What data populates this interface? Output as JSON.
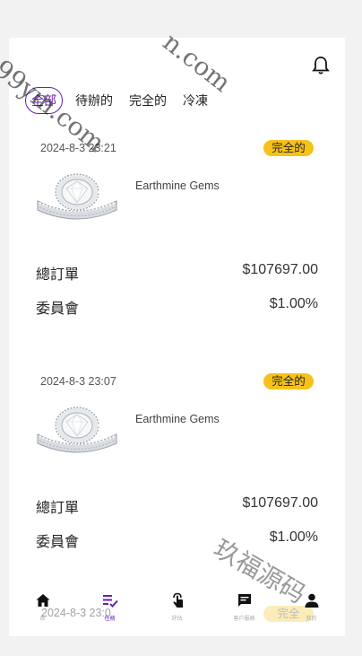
{
  "tabs": [
    {
      "label": "全部",
      "active": true
    },
    {
      "label": "待辦的",
      "active": false
    },
    {
      "label": "完全的",
      "active": false
    },
    {
      "label": "冷凍",
      "active": false
    }
  ],
  "orders": [
    {
      "date": "2024-8-3 23:21",
      "status": "完全的",
      "merchant": "Earthmine Gems",
      "total_label": "總訂單",
      "total_value": "$107697.00",
      "commission_label": "委員會",
      "commission_value": "$1.00%"
    },
    {
      "date": "2024-8-3 23:07",
      "status": "完全的",
      "merchant": "Earthmine Gems",
      "total_label": "總訂單",
      "total_value": "$107697.00",
      "commission_label": "委員會",
      "commission_value": "$1.00%"
    },
    {
      "date": "2024-8-3 23:0",
      "status": "完全"
    }
  ],
  "nav": [
    {
      "label": "首",
      "icon": "home-icon"
    },
    {
      "label": "任務",
      "icon": "task-list-icon"
    },
    {
      "label": "評估",
      "icon": "tap-icon"
    },
    {
      "label": "客戶服務",
      "icon": "chat-icon"
    },
    {
      "label": "我的",
      "icon": "user-icon"
    }
  ],
  "watermarks": [
    "n.com",
    "99ym.com",
    "玖福源码"
  ],
  "colors": {
    "accent": "#6b1fb3",
    "badge": "#f6c21a"
  }
}
